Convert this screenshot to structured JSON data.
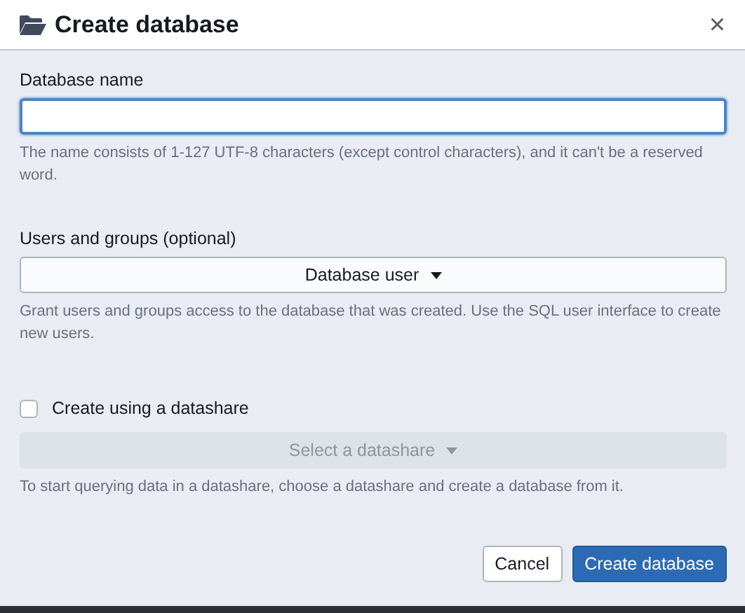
{
  "dialog": {
    "title": "Create database",
    "close": "×"
  },
  "name_field": {
    "label": "Database name",
    "focused": true,
    "hint": "The name consists of 1-127 UTF-8 characters (except control characters), and it can't be a reserved word."
  },
  "users_field": {
    "label": "Users and groups (optional)",
    "dropdown": {
      "value": "Database user",
      "disabled": false
    },
    "hint": "Grant users and groups access to the database that was created. Use the SQL user interface to create new users."
  },
  "datashare": {
    "checkbox": {
      "label": "Create using a datashare",
      "checked": false
    },
    "dropdown": {
      "value": "Select a datashare",
      "disabled": true
    },
    "hint": "To start querying data in a datashare, choose a datashare and create a database from it."
  },
  "buttons": [
    {
      "label": "Cancel",
      "kind": "secondary"
    },
    {
      "label": "Create database",
      "kind": "primary"
    }
  ]
}
